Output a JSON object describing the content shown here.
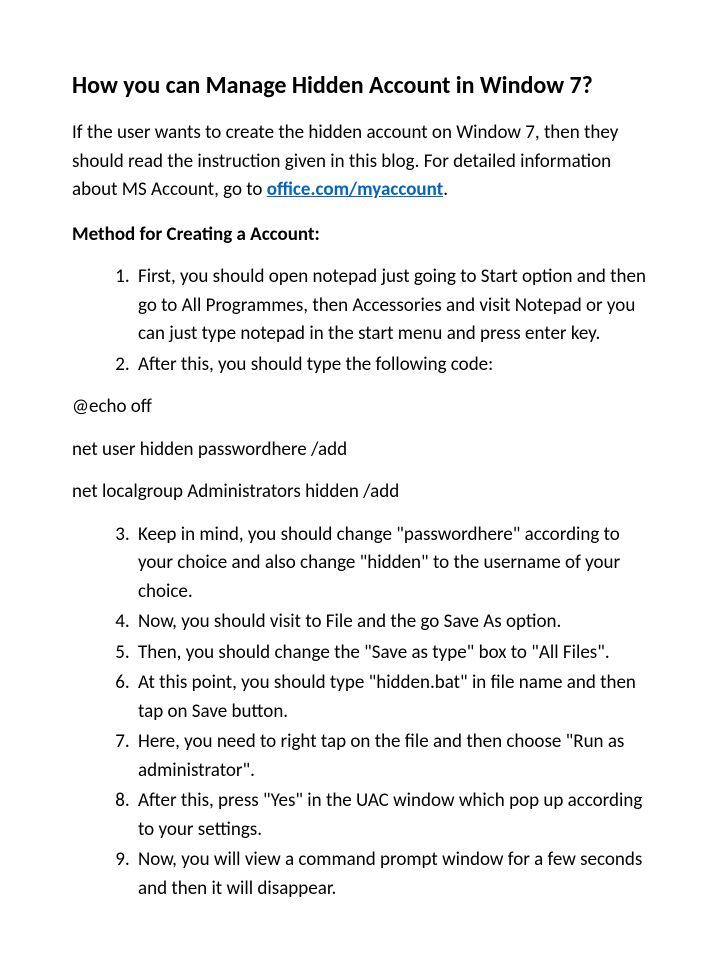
{
  "heading": "How you can Manage Hidden Account in Window 7?",
  "intro_before_link": "If the user wants to create the hidden account on Window 7, then they should read the instruction given in this blog. For detailed information about MS Account, go to ",
  "link_text": "office.com/myaccount",
  "intro_after_link": ".",
  "subheading": "Method for Creating a Account:",
  "list_part1": [
    "First, you should open notepad just going to Start option and then go to All Programmes, then Accessories and visit Notepad or you can just type notepad in the start menu and press enter key.",
    "After this, you should type the following code:"
  ],
  "code_lines": [
    "@echo off",
    "net user hidden passwordhere /add",
    "net localgroup Administrators hidden /add"
  ],
  "list_part2": [
    "Keep in mind, you should change \"passwordhere\" according to your choice and also change \"hidden\" to the username of your choice.",
    "Now, you should visit to File and the go  Save As option.",
    "Then, you should change the \"Save as type\" box to \"All Files\".",
    "At this point, you should type \"hidden.bat\" in file name and then tap on Save button.",
    "Here, you need to right tap on the file and then choose \"Run as administrator\".",
    "After this, press \"Yes\" in the UAC window which pop up according to your settings.",
    "Now, you will view a command prompt window for a few seconds and then it will disappear."
  ]
}
